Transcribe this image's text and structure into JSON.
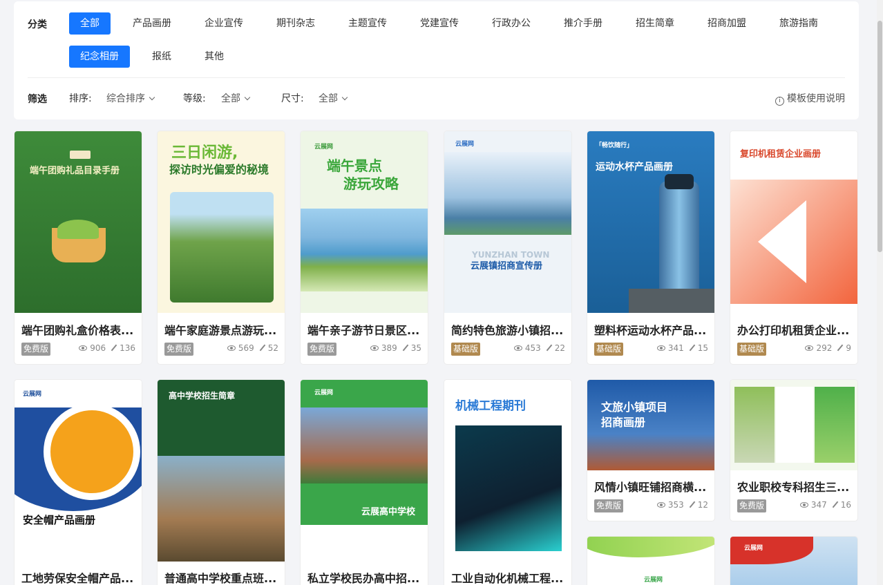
{
  "filter": {
    "category_label": "分类",
    "categories": [
      "全部",
      "产品画册",
      "企业宣传",
      "期刊杂志",
      "主题宣传",
      "党建宣传",
      "行政办公",
      "推介手册",
      "招生简章",
      "招商加盟",
      "旅游指南",
      "纪念相册",
      "报纸",
      "其他"
    ],
    "screen_label": "筛选",
    "sort_label": "排序:",
    "sort_value": "综合排序",
    "level_label": "等级:",
    "level_value": "全部",
    "size_label": "尺寸:",
    "size_value": "全部",
    "help_text": "模板使用说明"
  },
  "cards": [
    {
      "title": "端午团购礼盒价格表...",
      "badge": "免费版",
      "views": "906",
      "edits": "136",
      "thumb_title": "端午团购礼品目录手册",
      "thumb_sub": "云展网",
      "bg": "#3f8a3a"
    },
    {
      "title": "端午家庭游景点游玩...",
      "badge": "免费版",
      "views": "569",
      "edits": "52",
      "thumb_title": "三日闲游,",
      "thumb_title2": "探访时光偏爱的秘境",
      "bg": "#fbf6df"
    },
    {
      "title": "端午亲子游节日景区...",
      "badge": "免费版",
      "views": "389",
      "edits": "35",
      "thumb_title": "端午景点",
      "thumb_title2": "游玩攻略",
      "thumb_sub": "云展网",
      "bg": "#eef6e6"
    },
    {
      "title": "简约特色旅游小镇招...",
      "badge": "基础版",
      "views": "453",
      "edits": "22",
      "thumb_title": "YUNZHAN TOWN",
      "thumb_title2": "云展镇招商宣传册",
      "thumb_sub": "云展网",
      "bg": "#e8f1f8"
    },
    {
      "title": "塑料杯运动水杯产品...",
      "badge": "基础版",
      "views": "341",
      "edits": "15",
      "thumb_title": "运动水杯产品画册",
      "thumb_sub": "「畅饮随行」",
      "bg": "#1f6fae"
    },
    {
      "title": "办公打印机租赁企业...",
      "badge": "基础版",
      "views": "292",
      "edits": "9",
      "thumb_title": "复印机租赁企业画册",
      "bg": "#fdeee6"
    },
    {
      "title": "工地劳保安全帽产品...",
      "thumb_title": "安全帽产品画册",
      "thumb_sub": "云展网",
      "bg": "#ffffff"
    },
    {
      "title": "普通高中学校重点班...",
      "thumb_title": "高中学校招生简章",
      "bg": "#1e5a2f"
    },
    {
      "title": "私立学校民办高中招...",
      "thumb_title": "云展高中学校",
      "thumb_sub": "云展网",
      "bg": "#33a852"
    },
    {
      "title": "工业自动化机械工程...",
      "thumb_title": "机械工程期刊",
      "bg": "#0b2a3a"
    },
    {
      "title": "风情小镇旺铺招商横...",
      "badge": "免费版",
      "views": "353",
      "edits": "12",
      "thumb_title": "文旅小镇项目",
      "thumb_title2": "招商画册",
      "bg": "#1f5aa8"
    },
    {
      "title": "农业职校专科招生三...",
      "badge": "免费版",
      "views": "347",
      "edits": "16",
      "bg": "#f3f8ee"
    },
    {
      "title": "",
      "thumb_sub": "云展网",
      "bg": "#eaf5e0"
    },
    {
      "title": "",
      "thumb_sub": "云展网",
      "bg": "#d7322a"
    }
  ]
}
